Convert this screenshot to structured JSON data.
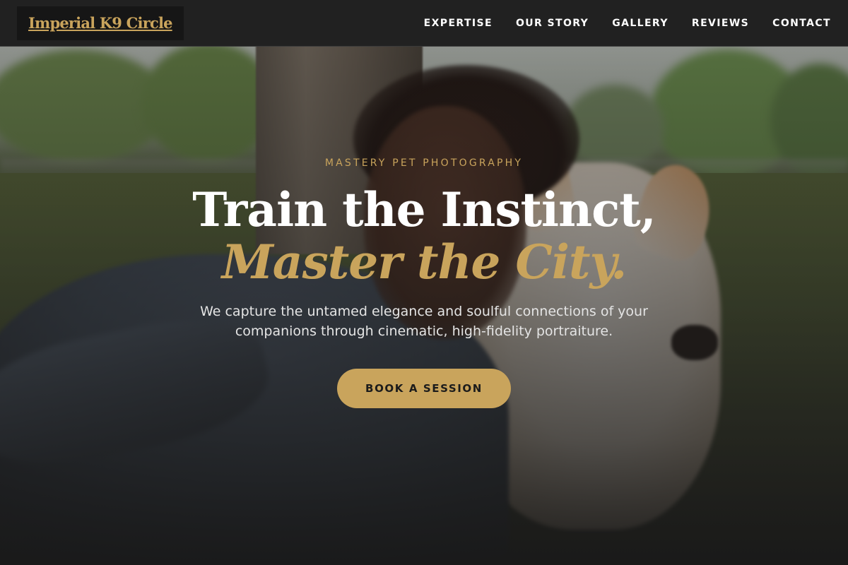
{
  "brand": {
    "name": "Imperial K9 Circle",
    "accent": "#c9a45c"
  },
  "nav": {
    "items": [
      {
        "label": "EXPERTISE"
      },
      {
        "label": "OUR STORY"
      },
      {
        "label": "GALLERY"
      },
      {
        "label": "REVIEWS"
      },
      {
        "label": "CONTACT"
      }
    ]
  },
  "hero": {
    "eyebrow": "MASTERY PET PHOTOGRAPHY",
    "title_line1": "Train the Instinct,",
    "title_line2": "Master the City.",
    "description": "We capture the untamed elegance and soulful connections of your companions through cinematic, high-fidelity portraiture.",
    "cta_label": "BOOK A SESSION"
  }
}
